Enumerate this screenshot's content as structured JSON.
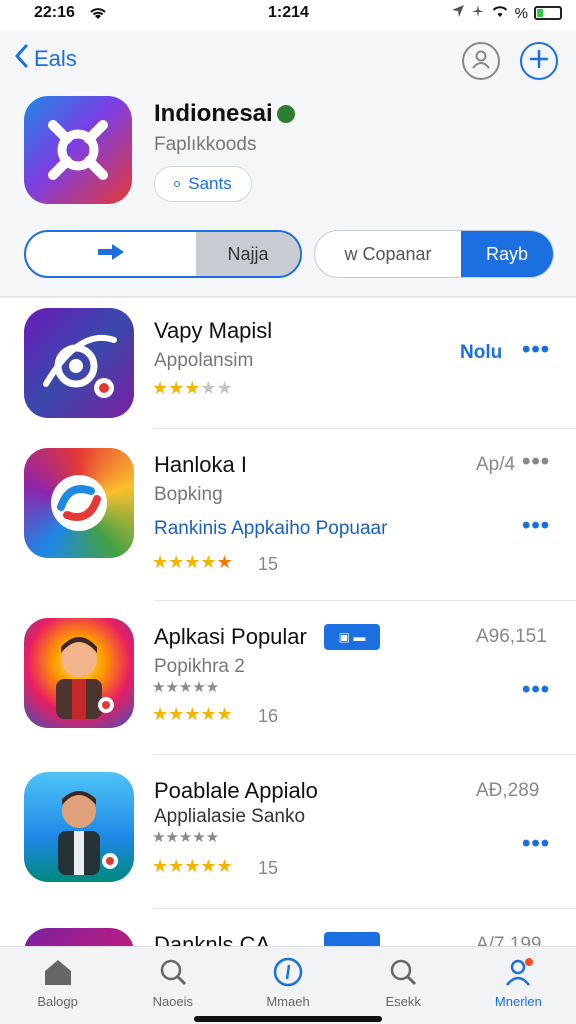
{
  "status": {
    "time_left": "22:16",
    "time_center": "1:214",
    "battery_text": "%"
  },
  "nav": {
    "back_label": "Eals"
  },
  "hero": {
    "title": "Indionesai",
    "subtitle": "Faplıkkoods",
    "chip_label": "Sants"
  },
  "segments": {
    "left_b": "Najja",
    "right_a": "w Copanar",
    "right_b": "Rayb"
  },
  "apps": [
    {
      "name": "Vapy Mapisl",
      "sub": "Appolansim",
      "price": "Nolu",
      "rating": 3,
      "stars_total": 5,
      "count": ""
    },
    {
      "name": "Hanloka I",
      "sub": "Bopking",
      "link": "Rankinis  Appkaiho Popuaar",
      "price": "Ap/4",
      "rating": 5,
      "stars_total": 5,
      "count": "15"
    },
    {
      "name": "Aplkasi Popular",
      "sub": "Popikhra 2",
      "price": "A96,151",
      "rating": 5,
      "stars_total": 5,
      "count": "16",
      "grey_rating": 5
    },
    {
      "name": "Poablale Appialo",
      "sub": "Applialasie Sanko",
      "price": "AÐ,289",
      "rating": 5,
      "stars_total": 5,
      "count": "15",
      "grey_rating": 5
    },
    {
      "name": "Danknls CA",
      "price": "A/7 199"
    }
  ],
  "tabs": [
    {
      "label": "Balogp"
    },
    {
      "label": "Naoeis"
    },
    {
      "label": "Mmaeh"
    },
    {
      "label": "Esekk"
    },
    {
      "label": "Mnerlen"
    }
  ]
}
